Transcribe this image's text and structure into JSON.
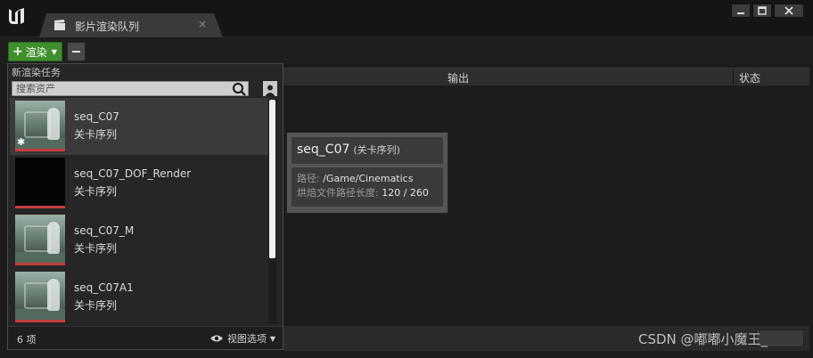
{
  "window": {
    "tab_title": "影片渲染队列",
    "tab_close": "×"
  },
  "toolbar": {
    "render_label": "渲染",
    "plus": "+"
  },
  "columns": {
    "output": "输出",
    "status": "状态"
  },
  "dropdown": {
    "title": "新渲染任务",
    "search_placeholder": "搜索资产",
    "items": [
      {
        "name": "seq_C07",
        "type": "关卡序列"
      },
      {
        "name": "seq_C07_DOF_Render",
        "type": "关卡序列"
      },
      {
        "name": "seq_C07_M",
        "type": "关卡序列"
      },
      {
        "name": "seq_C07A1",
        "type": "关卡序列"
      }
    ],
    "count": "6 项",
    "view_options": "视图选项"
  },
  "tooltip": {
    "name": "seq_C07",
    "type": "(关卡序列)",
    "path_label": "路径:",
    "path_value": "/Game/Cinematics",
    "length_label": "烘焙文件路径长度:",
    "length_value": "120 / 260"
  },
  "watermark": "CSDN @嘟嘟小魔王_",
  "colors": {
    "render_green": "#3f8f2d",
    "thumb_bar_red": "#c43e3e"
  },
  "icons": [
    "unreal-logo-icon",
    "clapperboard-icon",
    "minimize-icon",
    "maximize-icon",
    "close-icon",
    "search-icon",
    "person-icon",
    "eye-icon"
  ]
}
